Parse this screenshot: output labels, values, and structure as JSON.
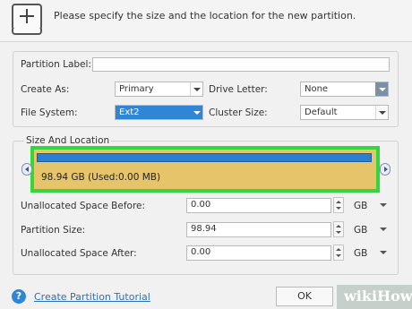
{
  "header": {
    "description": "Please specify the size and the location for the new partition."
  },
  "form": {
    "partition_label": {
      "label": "Partition Label:",
      "value": ""
    },
    "create_as": {
      "label": "Create As:",
      "value": "Primary"
    },
    "drive_letter": {
      "label": "Drive Letter:",
      "value": "None"
    },
    "file_system": {
      "label": "File System:",
      "value": "Ext2"
    },
    "cluster_size": {
      "label": "Cluster Size:",
      "value": "Default"
    }
  },
  "size_location": {
    "title": "Size And Location",
    "disk_text": "98.94 GB (Used:0.00 MB)",
    "fields": [
      {
        "label": "Unallocated Space Before:",
        "value": "0.00",
        "unit": "GB"
      },
      {
        "label": "Partition Size:",
        "value": "98.94",
        "unit": "GB"
      },
      {
        "label": "Unallocated Space After:",
        "value": "0.00",
        "unit": "GB"
      }
    ]
  },
  "footer": {
    "help_link": "Create Partition Tutorial",
    "ok_label": "OK"
  },
  "watermark": "wikiHow",
  "colors": {
    "highlight_border": "#33d63b",
    "disk_fill": "#e6c46a",
    "disk_bar": "#2a7fd0",
    "selection": "#2f86d6"
  }
}
